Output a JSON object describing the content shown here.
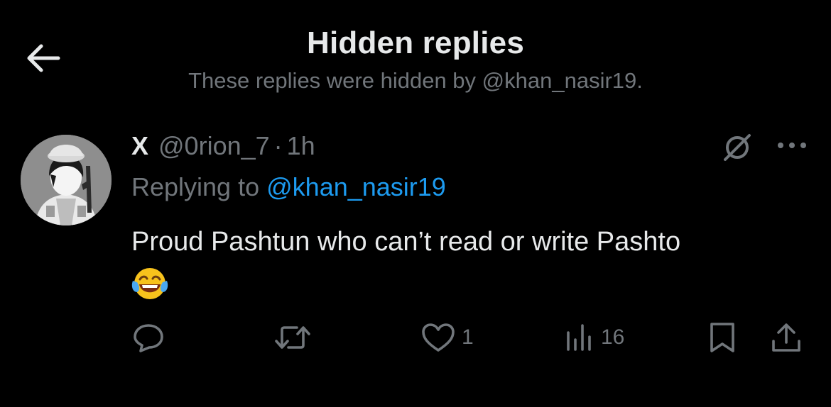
{
  "header": {
    "title": "Hidden replies",
    "subtitle": "These replies were hidden by @khan_nasir19."
  },
  "icons": {
    "back": "arrow-left-icon",
    "hidden": "hidden-reply-icon",
    "more": "more-options-icon",
    "reply": "reply-icon",
    "retweet": "retweet-icon",
    "like": "heart-icon",
    "views": "views-chart-icon",
    "bookmark": "bookmark-icon",
    "share": "share-icon"
  },
  "colors": {
    "background": "#000000",
    "text_primary": "#e7e9ea",
    "text_secondary": "#71767b",
    "link": "#1d9bf0"
  },
  "tweet": {
    "display_name": "X",
    "handle": "@0rion_7",
    "separator": "·",
    "time": "1h",
    "replying_prefix": "Replying to",
    "replying_to": "@khan_nasir19",
    "text": "Proud Pashtun who can’t read or write Pashto",
    "emoji": "face-with-tears-of-joy",
    "likes": "1",
    "views": "16"
  }
}
